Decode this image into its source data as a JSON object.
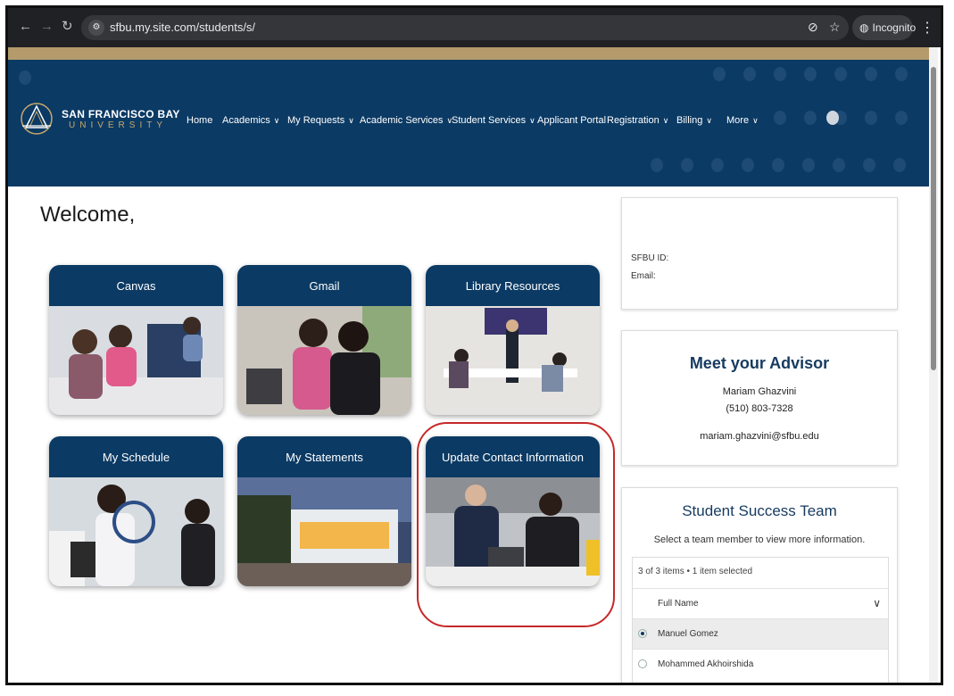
{
  "browser": {
    "url": "sfbu.my.site.com/students/s/",
    "incognito_label": "Incognito",
    "icons": [
      "back-icon",
      "forward-icon",
      "reload-icon",
      "site-settings-icon",
      "eye-off-icon",
      "star-icon",
      "incognito-icon",
      "more-icon"
    ]
  },
  "header": {
    "logo_name": "SAN FRANCISCO BAY",
    "logo_sub": "UNIVERSITY",
    "nav": [
      {
        "label": "Home",
        "dropdown": false
      },
      {
        "label": "Academics",
        "dropdown": true
      },
      {
        "label": "My Requests",
        "dropdown": true
      },
      {
        "label": "Academic Services",
        "dropdown": true
      },
      {
        "label": "Student Services",
        "dropdown": true
      },
      {
        "label": "Applicant Portal",
        "dropdown": false
      },
      {
        "label": "Registration",
        "dropdown": true
      },
      {
        "label": "Billing",
        "dropdown": true
      },
      {
        "label": "More",
        "dropdown": true
      }
    ],
    "colors": {
      "banner": "#0b3a64",
      "gold": "#b39b6b"
    }
  },
  "main": {
    "welcome": "Welcome,",
    "tiles": [
      {
        "label": "Canvas"
      },
      {
        "label": "Gmail"
      },
      {
        "label": "Library Resources"
      },
      {
        "label": "My Schedule"
      },
      {
        "label": "My Statements"
      },
      {
        "label": "Update Contact Information",
        "highlighted": true
      }
    ]
  },
  "profile": {
    "id_label": "SFBU ID:",
    "email_label": "Email:"
  },
  "advisor": {
    "title": "Meet your Advisor",
    "name": "Mariam Ghazvini",
    "phone": "(510) 803-7328",
    "email": "mariam.ghazvini@sfbu.edu"
  },
  "team": {
    "title": "Student Success Team",
    "subtitle": "Select a team member to view more information.",
    "status": "3 of 3 items • 1 item selected",
    "column": "Full Name",
    "rows": [
      {
        "name": "Manuel Gomez",
        "selected": true
      },
      {
        "name": "Mohammed Akhoirshida",
        "selected": false
      }
    ]
  }
}
